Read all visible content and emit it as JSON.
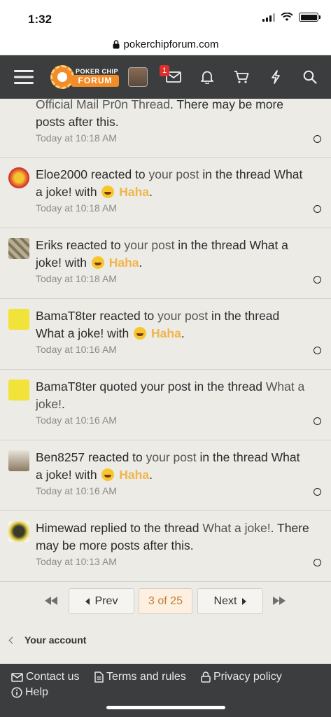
{
  "status_bar": {
    "time": "1:32"
  },
  "browser": {
    "url": "pokerchipforum.com"
  },
  "nav": {
    "logo_line1": "POKER CHIP",
    "logo_line2": "FORUM",
    "inbox_badge": "1"
  },
  "alerts": [
    {
      "parts": [
        {
          "t": "Official Mail Pr0n Thread",
          "c": "lnk"
        },
        {
          "t": ". There may be more posts after this.",
          "c": ""
        }
      ],
      "time": "Today at 10:18 AM"
    },
    {
      "parts": [
        {
          "t": "Eloe2000",
          "c": ""
        },
        {
          "t": " reacted to ",
          "c": ""
        },
        {
          "t": "your post",
          "c": "lnk"
        },
        {
          "t": " in the thread ",
          "c": ""
        },
        {
          "t": "What a joke!",
          "c": ""
        },
        {
          "t": " with ",
          "c": ""
        },
        {
          "t": "Haha",
          "c": "haha"
        },
        {
          "t": ".",
          "c": ""
        }
      ],
      "time": "Today at 10:18 AM"
    },
    {
      "parts": [
        {
          "t": "Eriks",
          "c": ""
        },
        {
          "t": " reacted to ",
          "c": ""
        },
        {
          "t": "your post",
          "c": "lnk"
        },
        {
          "t": " in the thread ",
          "c": ""
        },
        {
          "t": "What a joke!",
          "c": ""
        },
        {
          "t": " with ",
          "c": ""
        },
        {
          "t": "Haha",
          "c": "haha"
        },
        {
          "t": ".",
          "c": ""
        }
      ],
      "time": "Today at 10:18 AM"
    },
    {
      "parts": [
        {
          "t": "BamaT8ter",
          "c": ""
        },
        {
          "t": " reacted to ",
          "c": ""
        },
        {
          "t": "your post",
          "c": "lnk"
        },
        {
          "t": " in the thread ",
          "c": ""
        },
        {
          "t": "What a joke!",
          "c": ""
        },
        {
          "t": " with ",
          "c": ""
        },
        {
          "t": "Haha",
          "c": "haha"
        },
        {
          "t": ".",
          "c": ""
        }
      ],
      "time": "Today at 10:16 AM"
    },
    {
      "parts": [
        {
          "t": "BamaT8ter",
          "c": ""
        },
        {
          "t": " quoted ",
          "c": ""
        },
        {
          "t": "your post",
          "c": ""
        },
        {
          "t": " in the thread ",
          "c": ""
        },
        {
          "t": "What a joke!",
          "c": "lnk"
        },
        {
          "t": ".",
          "c": ""
        }
      ],
      "time": "Today at 10:16 AM"
    },
    {
      "parts": [
        {
          "t": "Ben8257",
          "c": ""
        },
        {
          "t": " reacted to ",
          "c": ""
        },
        {
          "t": "your post",
          "c": "lnk"
        },
        {
          "t": " in the thread ",
          "c": ""
        },
        {
          "t": "What a joke!",
          "c": ""
        },
        {
          "t": " with ",
          "c": ""
        },
        {
          "t": "Haha",
          "c": "haha"
        },
        {
          "t": ".",
          "c": ""
        }
      ],
      "time": "Today at 10:16 AM"
    },
    {
      "parts": [
        {
          "t": "Himewad",
          "c": ""
        },
        {
          "t": " replied to the thread ",
          "c": ""
        },
        {
          "t": "What a joke!",
          "c": "lnk"
        },
        {
          "t": ". There may be more posts after this.",
          "c": ""
        }
      ],
      "time": "Today at 10:13 AM"
    }
  ],
  "pager": {
    "prev_label": "Prev",
    "current_label": "3 of 25",
    "next_label": "Next"
  },
  "account_label": "Your account",
  "footer": {
    "contact": "Contact us",
    "terms": "Terms and rules",
    "privacy": "Privacy policy",
    "help": "Help"
  },
  "colors": {
    "nav_bg": "#3b3d3f",
    "accent_orange": "#f28c28",
    "haha_yellow": "#f2b54a",
    "badge_red": "#e0302e"
  }
}
